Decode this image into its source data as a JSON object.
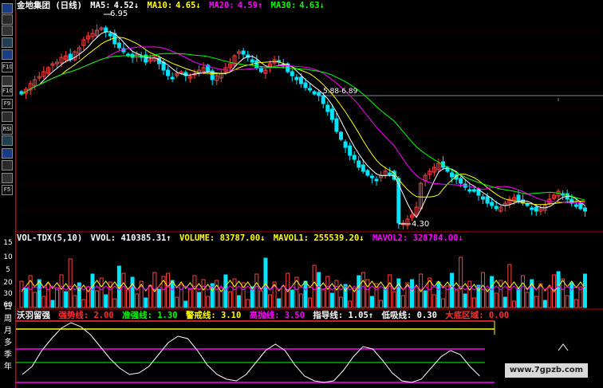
{
  "main_header": {
    "title": "金地集团 (日线)",
    "ma5_label": "MA5:",
    "ma5_value": "4.52↓",
    "ma10_label": "MA10:",
    "ma10_value": "4.65↓",
    "ma20_label": "MA20:",
    "ma20_value": "4.59↑",
    "ma30_label": "MA30:",
    "ma30_value": "4.63↓",
    "colors": {
      "title": "#ffffff",
      "ma5": "#ffffff",
      "ma10": "#ffff00",
      "ma20": "#ff00ff",
      "ma30": "#00ff00"
    }
  },
  "price_annotations": {
    "high": "6.95",
    "low": "4.30",
    "range_label": "5.88-6.89"
  },
  "vol_header": {
    "name": "VOL-TDX(5,10)",
    "vvol": "VVOL: 410385.31↑",
    "volume": "VOLUME: 83787.00↓",
    "mavol1": "MAVOL1: 255539.20↓",
    "mavol2": "MAVOL2: 328784.00↓"
  },
  "vol_axis": [
    "15",
    "10",
    "5",
    "20",
    "30",
    "60",
    "15"
  ],
  "ind_header": {
    "name": "沃羽留强",
    "l1": "强势线: 2.00",
    "l2": "准强线: 1.30",
    "l3": "警戒线: 3.10",
    "l4": "高抛线: 3.50",
    "l5": "指导线: 1.05↑",
    "l6": "低吸线: 0.30",
    "l7": "大底区域: 0.00"
  },
  "left_labels": [
    "日",
    "周",
    "月",
    "多",
    "季",
    "年"
  ],
  "toolbar_icons": [
    "chart-icon",
    "line-icon",
    "bar-icon",
    "kline-icon",
    "layout-icon",
    "fund-icon",
    "finance-icon",
    "f10-icon",
    "f9-icon",
    "sign-icon",
    "rsi-icon",
    "money-icon",
    "move-icon",
    "switch-icon",
    "pen-icon",
    "f5-icon"
  ],
  "toolbar_texts": [
    "",
    "",
    "",
    "",
    "",
    "F10",
    "",
    "F10",
    "F9",
    "",
    "RSI",
    "",
    "",
    "",
    "",
    "F5"
  ],
  "watermark": "www.7gpzb.com",
  "chart_data": {
    "type": "candlestick",
    "note": "price series shown as daily candles with MA lines, volume bars and indicator line",
    "price_range": [
      4.3,
      6.95
    ],
    "ma_series": [
      "MA5",
      "MA10",
      "MA20",
      "MA30"
    ]
  }
}
